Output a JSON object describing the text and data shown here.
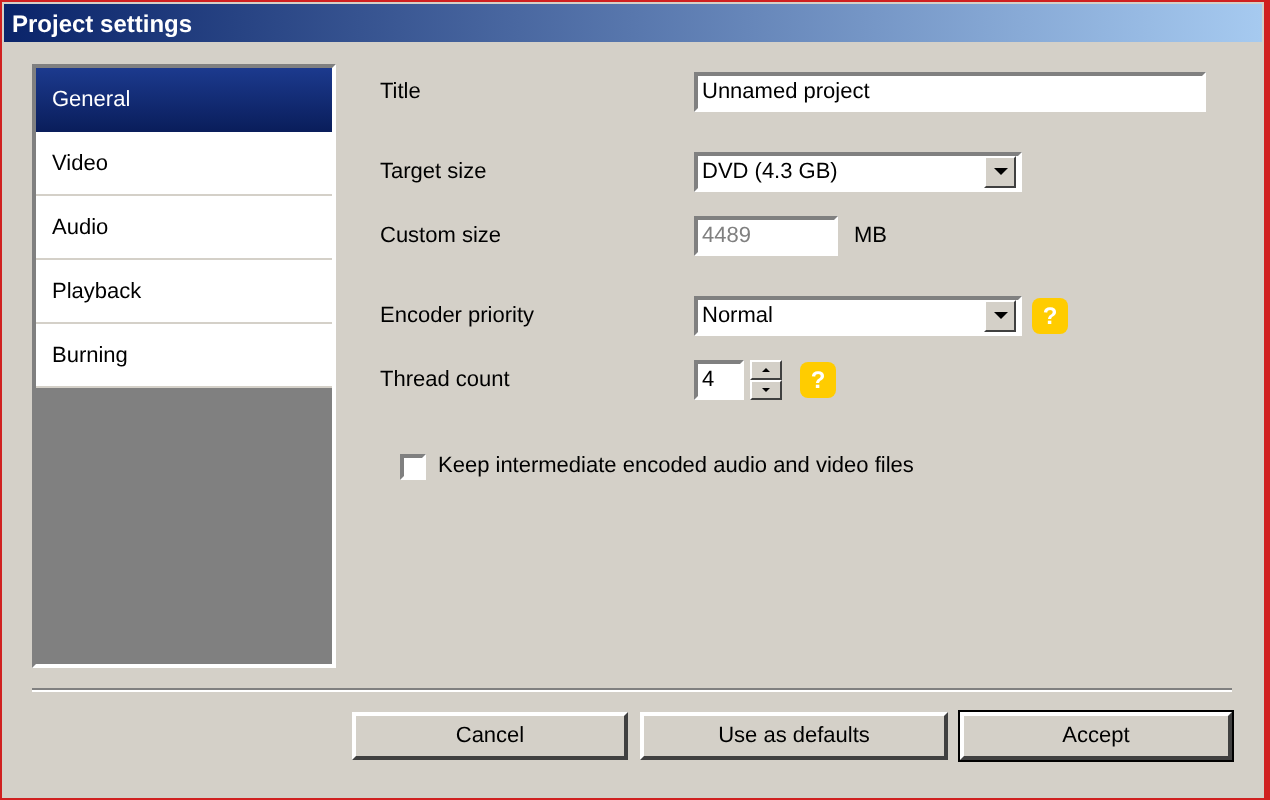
{
  "window": {
    "title": "Project settings"
  },
  "sidebar": {
    "items": [
      {
        "label": "General",
        "selected": true
      },
      {
        "label": "Video",
        "selected": false
      },
      {
        "label": "Audio",
        "selected": false
      },
      {
        "label": "Playback",
        "selected": false
      },
      {
        "label": "Burning",
        "selected": false
      }
    ]
  },
  "form": {
    "rows": [
      {
        "kind": "text",
        "label": "Title",
        "value": "Unnamed project"
      },
      {
        "kind": "select",
        "label": "Target size",
        "value": "DVD (4.3 GB)"
      },
      {
        "kind": "number",
        "label": "Custom size",
        "value": "4489",
        "unit": "MB",
        "disabled": true
      },
      {
        "kind": "select",
        "label": "Encoder priority",
        "value": "Normal",
        "help": "?"
      },
      {
        "kind": "spin",
        "label": "Thread count",
        "value": "4",
        "help": "?"
      },
      {
        "kind": "checkbox",
        "label": "Keep intermediate encoded audio and video files",
        "checked": false
      }
    ]
  },
  "buttons": [
    {
      "label": "Cancel",
      "default": false
    },
    {
      "label": "Use as defaults",
      "default": false
    },
    {
      "label": "Accept",
      "default": true
    }
  ]
}
